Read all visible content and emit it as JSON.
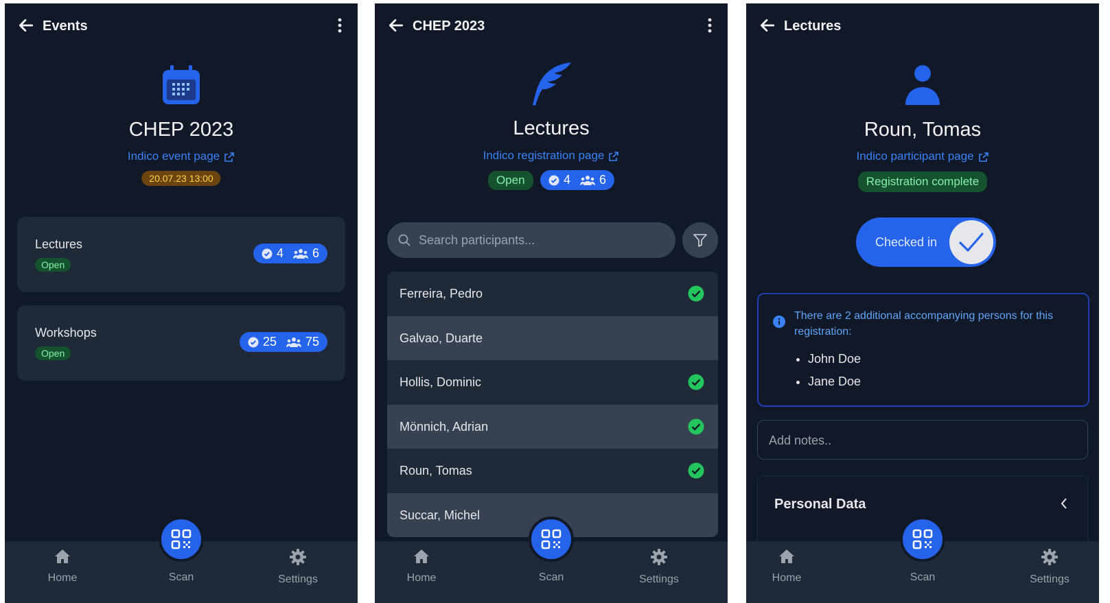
{
  "colors": {
    "background": "#111827",
    "card": "#1f2937",
    "accent": "#2563eb",
    "link": "#3b82f6",
    "success": "#22c55e"
  },
  "nav": {
    "home": "Home",
    "scan": "Scan",
    "settings": "Settings"
  },
  "screen1": {
    "top_title": "Events",
    "icon": "calendar-icon",
    "title": "CHEP 2023",
    "link": "Indico event page",
    "date": "20.07.23 13:00",
    "cards": [
      {
        "title": "Lectures",
        "status": "Open",
        "checked": "4",
        "total": "6"
      },
      {
        "title": "Workshops",
        "status": "Open",
        "checked": "25",
        "total": "75"
      }
    ]
  },
  "screen2": {
    "top_title": "CHEP 2023",
    "icon": "feather-icon",
    "title": "Lectures",
    "link": "Indico registration page",
    "status": "Open",
    "checked": "4",
    "total": "6",
    "search_placeholder": "Search participants...",
    "participants": [
      {
        "name": "Ferreira, Pedro",
        "checked_in": true
      },
      {
        "name": "Galvao, Duarte",
        "checked_in": false
      },
      {
        "name": "Hollis, Dominic",
        "checked_in": true
      },
      {
        "name": "Mönnich, Adrian",
        "checked_in": true
      },
      {
        "name": "Roun, Tomas",
        "checked_in": true
      },
      {
        "name": "Succar, Michel",
        "checked_in": false
      }
    ]
  },
  "screen3": {
    "top_title": "Lectures",
    "icon": "user-icon",
    "title": "Roun, Tomas",
    "link": "Indico participant page",
    "status": "Registration complete",
    "toggle_label": "Checked in",
    "info": "There are 2 additional accompanying persons for this registration:",
    "persons": [
      "John Doe",
      "Jane Doe"
    ],
    "notes_placeholder": "Add notes..",
    "section": "Personal Data"
  }
}
